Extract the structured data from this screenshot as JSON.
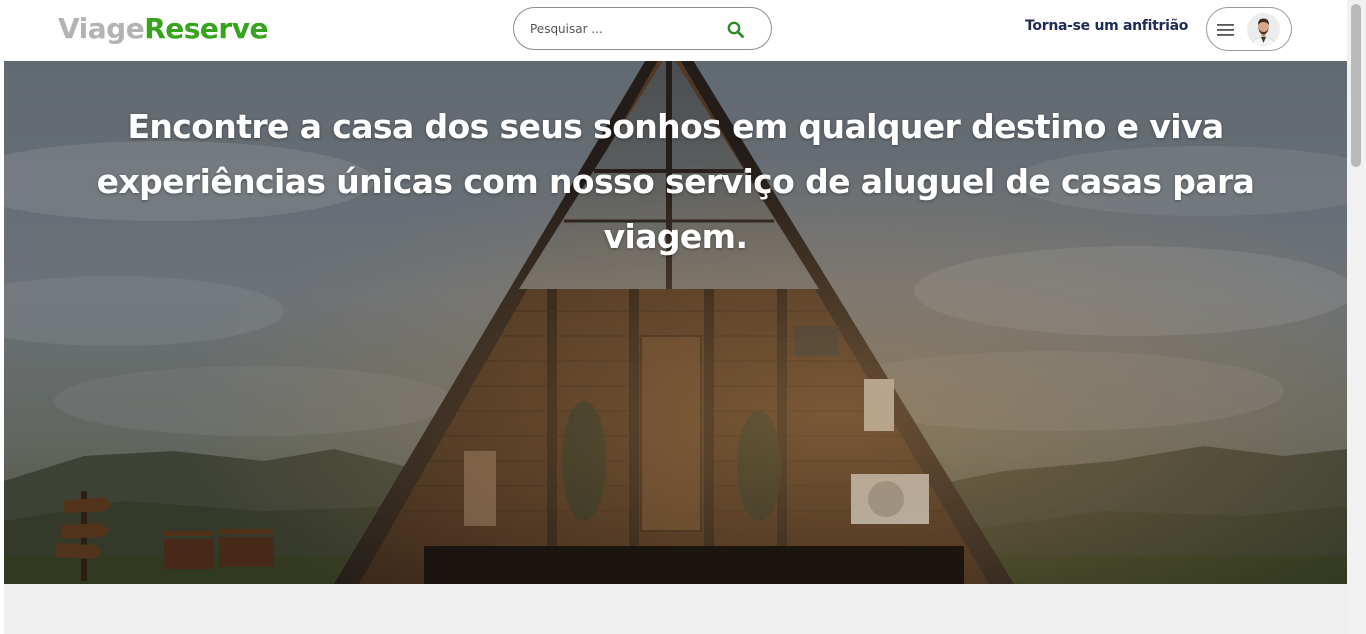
{
  "header": {
    "logo_part1": "Viage",
    "logo_part2": "Reserve",
    "search_placeholder": "Pesquisar ...",
    "host_link": "Torna-se um anfitrião"
  },
  "hero": {
    "headline": "Encontre a casa dos seus sonhos em qualquer destino e viva experiências únicas com nosso serviço de aluguel de casas para viagem."
  },
  "icons": {
    "search": "search-icon",
    "menu": "hamburger-menu-icon",
    "avatar": "user-avatar"
  },
  "colors": {
    "logo_gray": "#b3b3b3",
    "logo_green": "#36a41c",
    "host_link": "#1f2a56",
    "search_icon": "#2e8b2e"
  }
}
